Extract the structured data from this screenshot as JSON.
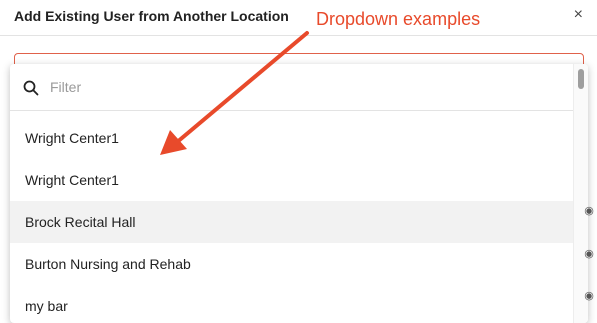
{
  "modal": {
    "title": "Add Existing User from Another Location",
    "close_glyph": "×"
  },
  "dropdown": {
    "filter_placeholder": "Filter",
    "filter_value": "",
    "options": [
      {
        "label": "Wright Center1"
      },
      {
        "label": "Wright Center1"
      },
      {
        "label": "Brock Recital Hall"
      },
      {
        "label": "Burton Nursing and Rehab"
      },
      {
        "label": "my bar"
      }
    ],
    "highlighted_index": 2
  },
  "annotation": {
    "text": "Dropdown examples"
  },
  "colors": {
    "annotation": "#e84a2b",
    "select_border": "#e0614a",
    "highlight": "#f2f2f2",
    "accent": "#1f6fd1"
  },
  "icons": {
    "search": "search-icon",
    "close": "close-icon",
    "arrow": "arrow-icon"
  }
}
